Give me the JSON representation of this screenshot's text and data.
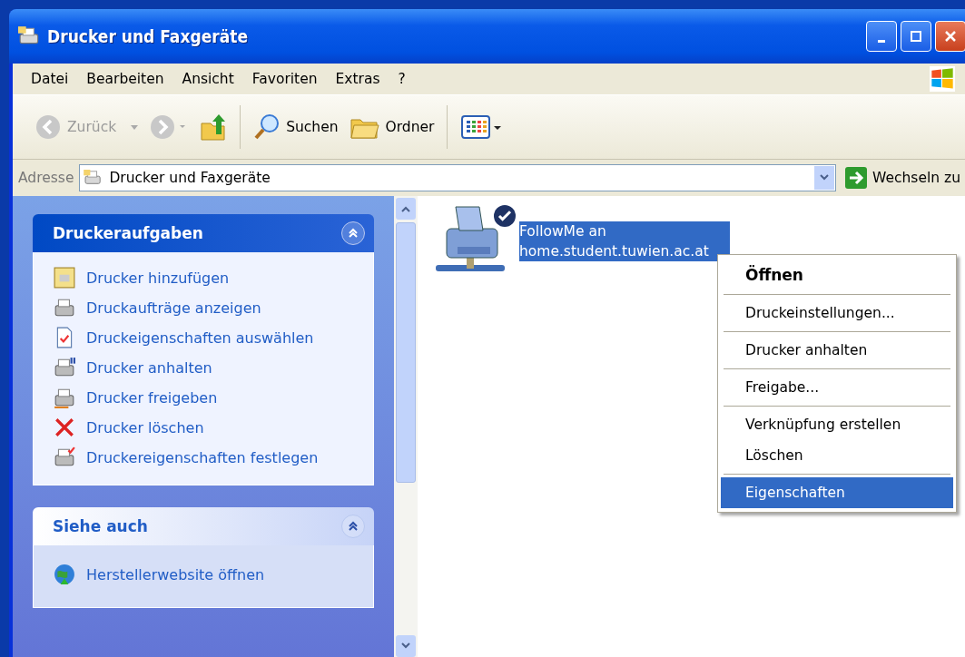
{
  "window": {
    "title": "Drucker und Faxgeräte"
  },
  "menu_bar": [
    "Datei",
    "Bearbeiten",
    "Ansicht",
    "Favoriten",
    "Extras",
    "?"
  ],
  "toolbar": {
    "back": {
      "label": "Zurück",
      "disabled": true
    },
    "search": "Suchen",
    "folders": "Ordner"
  },
  "address_bar": {
    "label": "Adresse",
    "value": "Drucker und Faxgeräte",
    "go": "Wechseln zu"
  },
  "task_panels": [
    {
      "title": "Druckeraufgaben",
      "expanded": true,
      "items": [
        "Drucker hinzufügen",
        "Druckaufträge anzeigen",
        "Druckeigenschaften auswählen",
        "Drucker anhalten",
        "Drucker freigeben",
        "Drucker löschen",
        "Druckereigenschaften festlegen"
      ]
    },
    {
      "title": "Siehe auch",
      "expanded": true,
      "items": [
        "Herstellerwebsite öffnen"
      ]
    }
  ],
  "printers": [
    {
      "name": "FollowMe an home.student.tuwien.ac.at",
      "selected": true,
      "default": true
    }
  ],
  "context_menu": [
    {
      "kind": "item",
      "label": "Öffnen",
      "default": true,
      "selected": false
    },
    {
      "kind": "separator"
    },
    {
      "kind": "item",
      "label": "Druckeinstellungen...",
      "default": false,
      "selected": false
    },
    {
      "kind": "separator"
    },
    {
      "kind": "item",
      "label": "Drucker anhalten",
      "default": false,
      "selected": false
    },
    {
      "kind": "separator"
    },
    {
      "kind": "item",
      "label": "Freigabe...",
      "default": false,
      "selected": false
    },
    {
      "kind": "separator"
    },
    {
      "kind": "item",
      "label": "Verknüpfung erstellen",
      "default": false,
      "selected": false
    },
    {
      "kind": "item",
      "label": "Löschen",
      "default": false,
      "selected": false
    },
    {
      "kind": "separator"
    },
    {
      "kind": "item",
      "label": "Eigenschaften",
      "default": false,
      "selected": true
    }
  ]
}
